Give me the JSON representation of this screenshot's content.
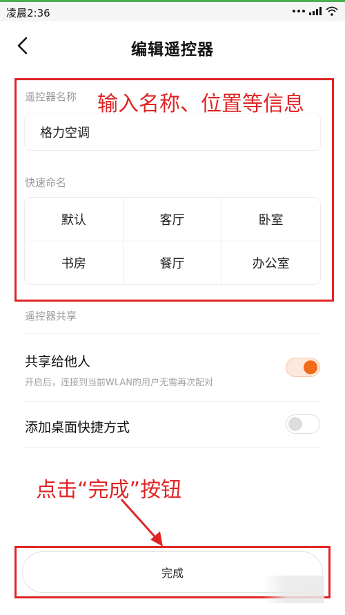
{
  "status_bar": {
    "time": "凌晨2:36"
  },
  "header": {
    "title": "编辑遥控器"
  },
  "name_section": {
    "label": "遥控器名称",
    "input_value": "格力空调"
  },
  "quick_name": {
    "label": "快速命名",
    "options": [
      "默认",
      "客厅",
      "卧室",
      "书房",
      "餐厅",
      "办公室"
    ]
  },
  "share_section": {
    "label": "遥控器共享",
    "share_toggle": {
      "title": "共享给他人",
      "description": "开启后，连接到当前WLAN的用户无需再次配对",
      "enabled": true
    },
    "shortcut_toggle": {
      "title": "添加桌面快捷方式",
      "enabled": false
    }
  },
  "annotations": {
    "top": "输入名称、位置等信息",
    "bottom": "点击“完成”按钮"
  },
  "footer": {
    "done_label": "完成"
  },
  "colors": {
    "accent": "#f26b18",
    "annotation": "#e02424"
  }
}
